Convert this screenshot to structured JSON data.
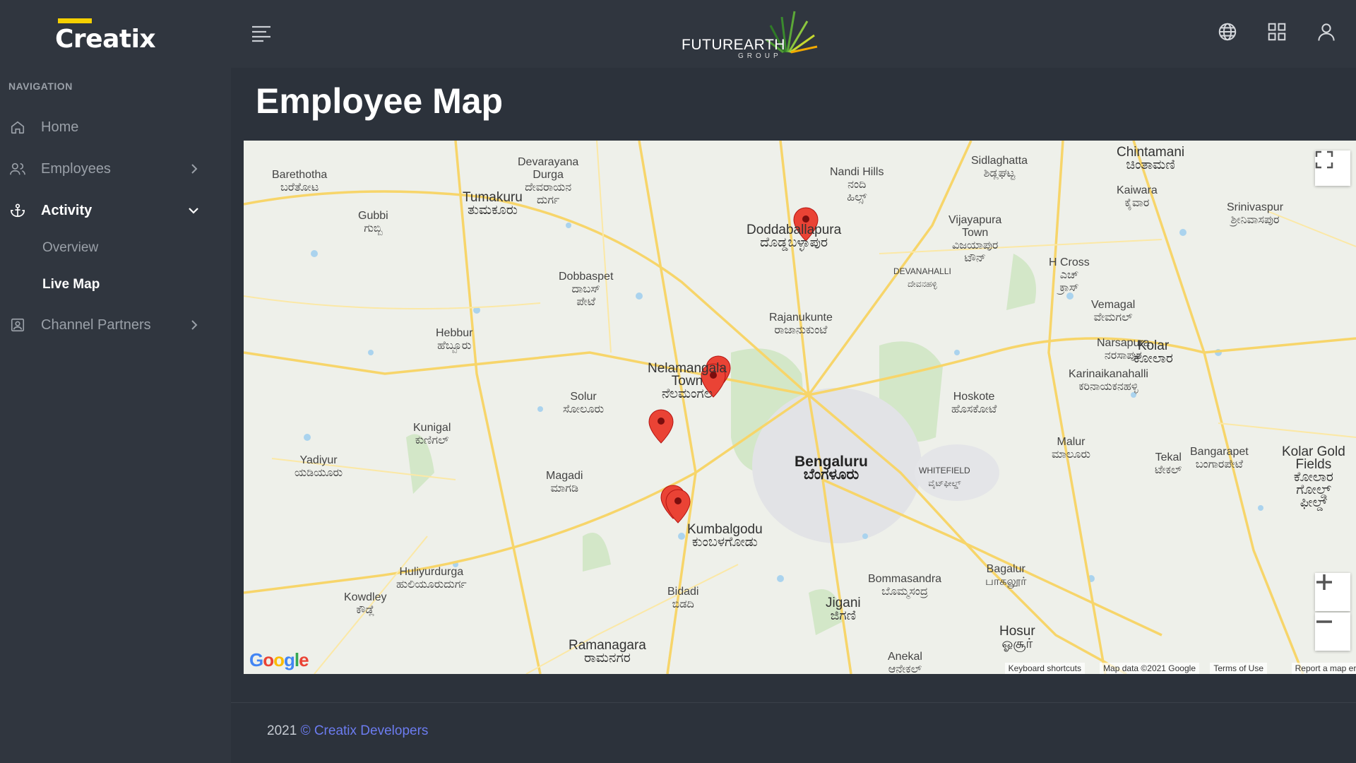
{
  "app": {
    "logo_text": "Creatix",
    "brand_name": "FUTUREARTH",
    "brand_sub": "GROUP"
  },
  "sidebar": {
    "nav_label": "NAVIGATION",
    "items": [
      {
        "label": "Home",
        "icon": "home-icon"
      },
      {
        "label": "Employees",
        "icon": "users-icon"
      },
      {
        "label": "Activity",
        "icon": "anchor-icon"
      },
      {
        "label": "Channel Partners",
        "icon": "contact-card-icon"
      }
    ],
    "activity_sub": [
      {
        "label": "Overview"
      },
      {
        "label": "Live Map"
      }
    ]
  },
  "page": {
    "title": "Employee Map"
  },
  "map": {
    "labels": [
      {
        "text": "Tumakuru\nತುಮಕೂರು",
        "cls": "big"
      },
      {
        "text": "Doddaballapura\nದೊಡ್ಡಬಳ್ಳಾಪುರ",
        "cls": "big"
      },
      {
        "text": "Nelamangala\nTown\nನೆಲಮಂಗಲ",
        "cls": "big"
      },
      {
        "text": "Bengaluru\nಬೆಂಗಳೂರು",
        "cls": "city"
      },
      {
        "text": "Kumbalgodu\nಕುಂಬಳಗೋಡು",
        "cls": "big"
      },
      {
        "text": "Hoskote\nಹೊಸಕೋಟೆ",
        "cls": ""
      },
      {
        "text": "Kolar\nಕೋಲಾರ",
        "cls": "big"
      },
      {
        "text": "Hosur\nஓசூர்",
        "cls": "big"
      },
      {
        "text": "Ramanagara\nರಾಮನಗರ",
        "cls": "big"
      },
      {
        "text": "Magadi\nಮಾಗಡಿ",
        "cls": ""
      },
      {
        "text": "Chintamani\nಚಿಂತಾಮಣಿ",
        "cls": "big"
      },
      {
        "text": "Devarayana\nDurga\nದೇವರಾಯನ\nದುರ್ಗ",
        "cls": ""
      },
      {
        "text": "Nandi Hills\nನಂದಿ\nಹಿಲ್ಸ್",
        "cls": ""
      },
      {
        "text": "Sidlaghatta\nಶಿಡ್ಲಘಟ್ಟ",
        "cls": ""
      },
      {
        "text": "Vijayapura\nTown\nವಿಜಯಾಪುರ\nಟೌನ್",
        "cls": ""
      },
      {
        "text": "Jigani\nಜಿಗಣಿ",
        "cls": "big"
      },
      {
        "text": "Bommasandra\nಬೊಮ್ಮಸಂದ್ರ",
        "cls": ""
      },
      {
        "text": "Bidadi\nಬಿಡದಿ",
        "cls": ""
      },
      {
        "text": "Malur\nಮಾಲೂರು",
        "cls": ""
      },
      {
        "text": "Kolar Gold\nFields\nಕೋಲಾರ\nಗೋಲ್ಡ್\nಫೀಲ್ಡ್",
        "cls": "big"
      },
      {
        "text": "Hebbur\nಹೆಬ್ಬೂರು",
        "cls": ""
      },
      {
        "text": "Solur\nಸೋಲೂರು",
        "cls": ""
      },
      {
        "text": "Kunigal\nಕುಣಿಗಲ್",
        "cls": ""
      },
      {
        "text": "Yadiyur\nಯಡಿಯೂರು",
        "cls": ""
      },
      {
        "text": "Huliyurdurga\nಹುಲಿಯೂರುದುರ್ಗ",
        "cls": ""
      },
      {
        "text": "Kowdley\nಕೌಡ್ಲೆ",
        "cls": ""
      },
      {
        "text": "Rajanukunte\nರಾಜಾನುಕುಂಟೆ",
        "cls": ""
      },
      {
        "text": "Dobbaspet\nದಾಬಸ್\nಪೇಟೆ",
        "cls": ""
      },
      {
        "text": "Barethotha\nಬರೆತೋಟ",
        "cls": ""
      },
      {
        "text": "Gubbi\nಗುಬ್ಬಿ",
        "cls": ""
      },
      {
        "text": "Narsapura\nನರಸಾಪುರ",
        "cls": ""
      },
      {
        "text": "Vemagal\nವೇಮಗಲ್",
        "cls": ""
      },
      {
        "text": "Bagalur\nபாகலூர்",
        "cls": ""
      },
      {
        "text": "Anekal\nಆನೇಕಲ್",
        "cls": ""
      },
      {
        "text": "Kaiwara\nಕೈವಾರ",
        "cls": ""
      },
      {
        "text": "Srinivaspur\nಶ್ರೀನಿವಾಸಪುರ",
        "cls": ""
      },
      {
        "text": "H Cross\nಎಚ್\nಕ್ರಾಸ್",
        "cls": ""
      },
      {
        "text": "Karinaikanahalli\nಕರಿನಾಯಕನಹಳ್ಳಿ",
        "cls": ""
      },
      {
        "text": "Tekal\nಟೇಕಲ್",
        "cls": ""
      },
      {
        "text": "Bangarapet\nಬಂಗಾರಪೇಟೆ",
        "cls": ""
      },
      {
        "text": "WHITEFIELD\nವೈಟ್‌ಫೀಲ್ಡ್",
        "cls": ""
      },
      {
        "text": "DEVANAHALLI\nದೇವನಹಳ್ಳಿ",
        "cls": ""
      }
    ],
    "attribution": {
      "shortcuts": "Keyboard shortcuts",
      "data": "Map data ©2021 Google",
      "terms": "Terms of Use",
      "report": "Report a map error"
    },
    "google_logo": "Google",
    "markers": 6
  },
  "footer": {
    "year": "2021",
    "link": "© Creatix Developers"
  }
}
